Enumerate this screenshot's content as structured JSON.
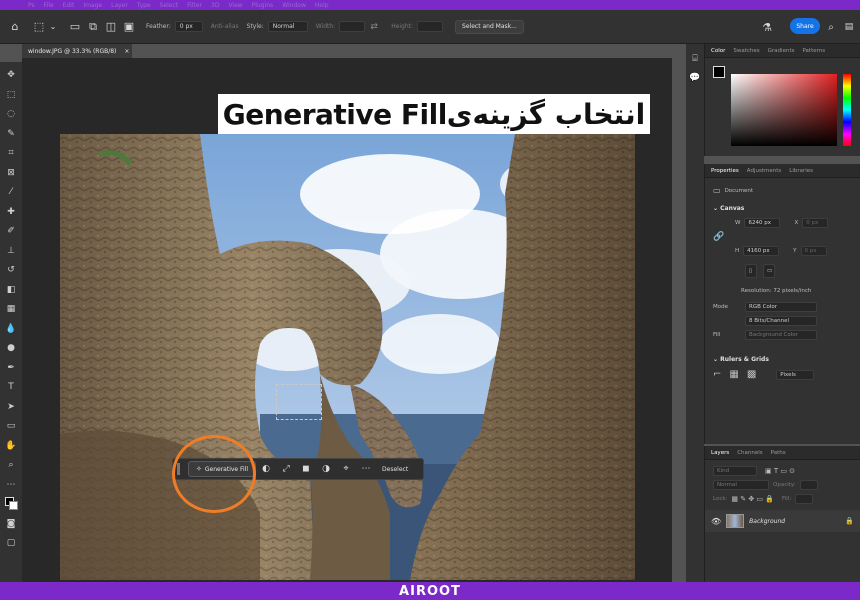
{
  "menubar": [
    "Ps",
    "File",
    "Edit",
    "Image",
    "Layer",
    "Type",
    "Select",
    "Filter",
    "3D",
    "View",
    "Plugins",
    "Window",
    "Help"
  ],
  "options": {
    "feather_label": "Feather:",
    "feather_value": "0 px",
    "antialias_label": "Anti-alias",
    "style_label": "Style:",
    "style_value": "Normal",
    "width_label": "Width:",
    "height_label": "Height:",
    "select_mask_label": "Select and Mask...",
    "share_label": "Share"
  },
  "document": {
    "tab_title": "window.JPG @ 33.3% (RGB/8)",
    "close_glyph": "×"
  },
  "overlay_title": "انتخاب گزینه‌یGenerative Fill",
  "context_bar": {
    "generative_fill_label": "Generative Fill",
    "deselect_label": "Deselect"
  },
  "color_panel": {
    "tabs": [
      "Color",
      "Swatches",
      "Gradients",
      "Patterns"
    ],
    "active_tab": "Color"
  },
  "properties_panel": {
    "tabs": [
      "Properties",
      "Adjustments",
      "Libraries"
    ],
    "active_tab": "Properties",
    "document_label": "Document",
    "canvas_title": "Canvas",
    "w_label": "W",
    "w_value": "6240 px",
    "h_label": "H",
    "h_value": "4160 px",
    "x_label": "X",
    "x_value": "0 px",
    "y_label": "Y",
    "y_value": "0 px",
    "resolution": "Resolution: 72 pixels/inch",
    "mode_label": "Mode",
    "mode_value": "RGB Color",
    "depth_value": "8 Bits/Channel",
    "fill_label": "Fill",
    "fill_value": "Background Color",
    "rulers_title": "Rulers & Grids",
    "units_value": "Pixels"
  },
  "layers_panel": {
    "tabs": [
      "Layers",
      "Channels",
      "Paths"
    ],
    "active_tab": "Layers",
    "kind_label": "Kind",
    "blend_value": "Normal",
    "opacity_label": "Opacity:",
    "lock_label": "Lock:",
    "fill_label": "Fill:",
    "layer_name": "Background"
  },
  "brand": "AIROOT",
  "colors": {
    "accent_purple": "#7b2ac9",
    "ring_orange": "#f07d25",
    "share_blue": "#1473e6"
  }
}
